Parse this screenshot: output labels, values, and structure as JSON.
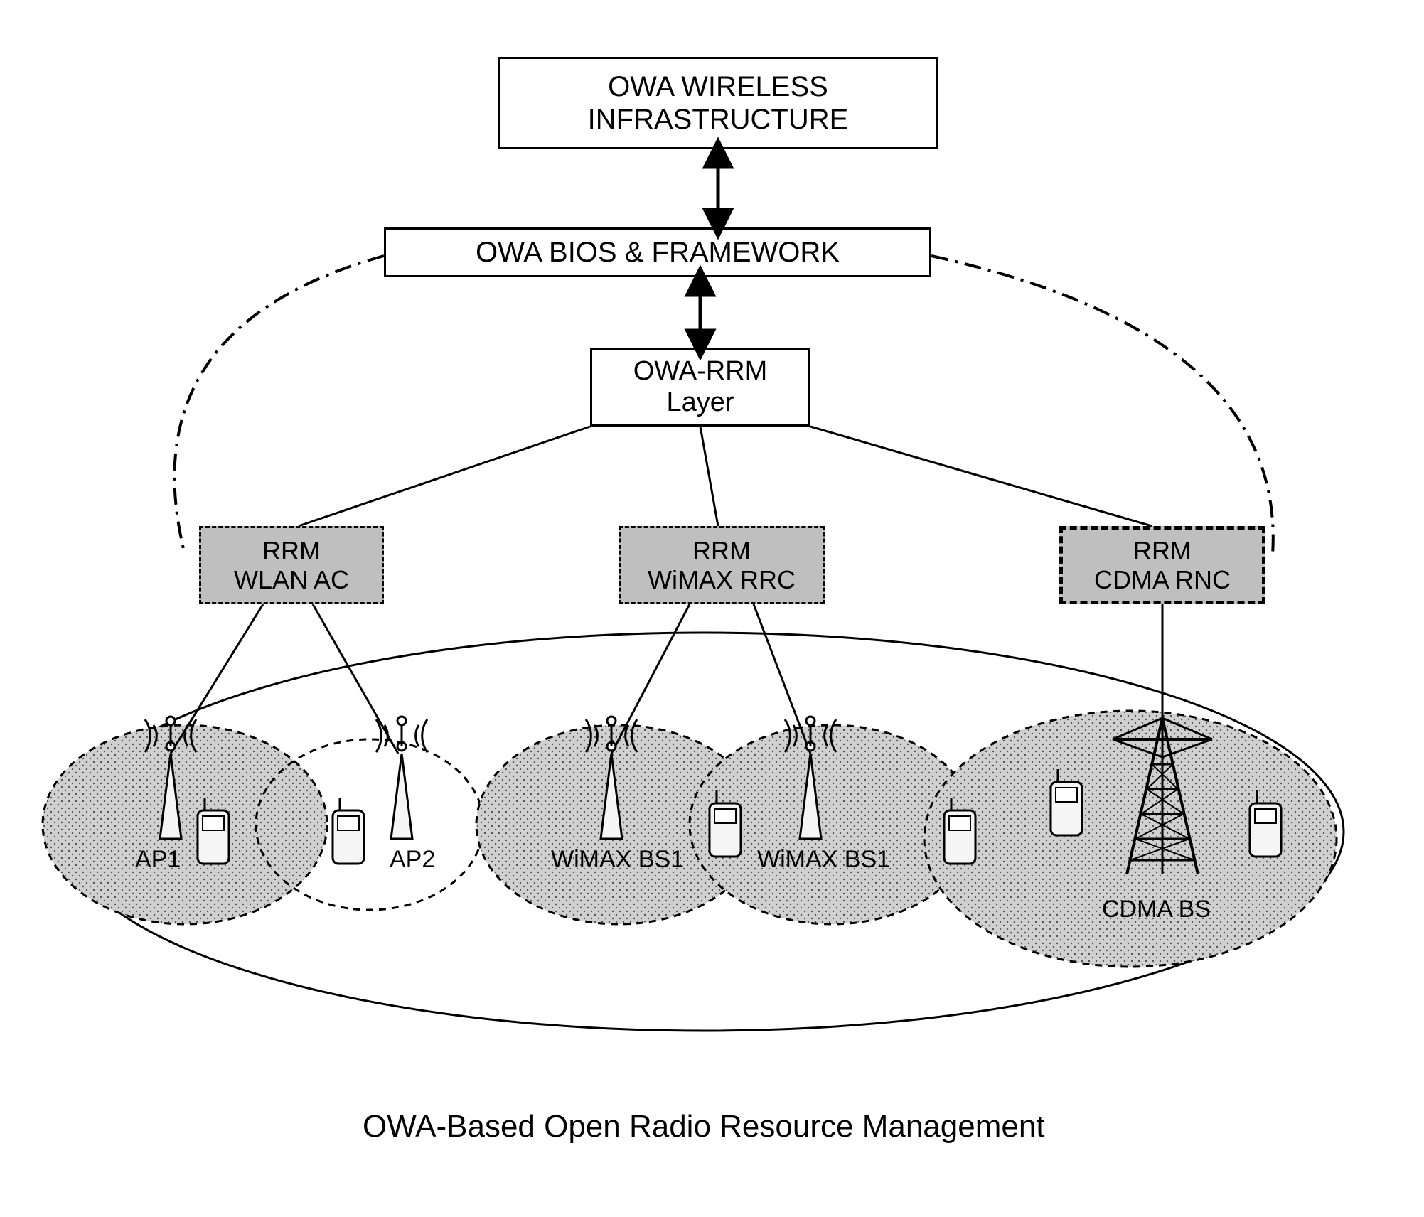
{
  "top_box": {
    "line1": "OWA WIRELESS",
    "line2": "INFRASTRUCTURE"
  },
  "bios_box": "OWA BIOS & FRAMEWORK",
  "rrm_layer": {
    "line1": "OWA-RRM",
    "line2": "Layer"
  },
  "rrm_wlan": {
    "line1": "RRM",
    "line2": "WLAN AC"
  },
  "rrm_wimax": {
    "line1": "RRM",
    "line2": "WiMAX RRC"
  },
  "rrm_cdma": {
    "line1": "RRM",
    "line2": "CDMA RNC"
  },
  "cells": {
    "ap1": "AP1",
    "ap2": "AP2",
    "wimax_bs1a": "WiMAX BS1",
    "wimax_bs1b": "WiMAX BS1",
    "cdma_bs": "CDMA BS"
  },
  "caption": "OWA-Based Open Radio Resource Management"
}
